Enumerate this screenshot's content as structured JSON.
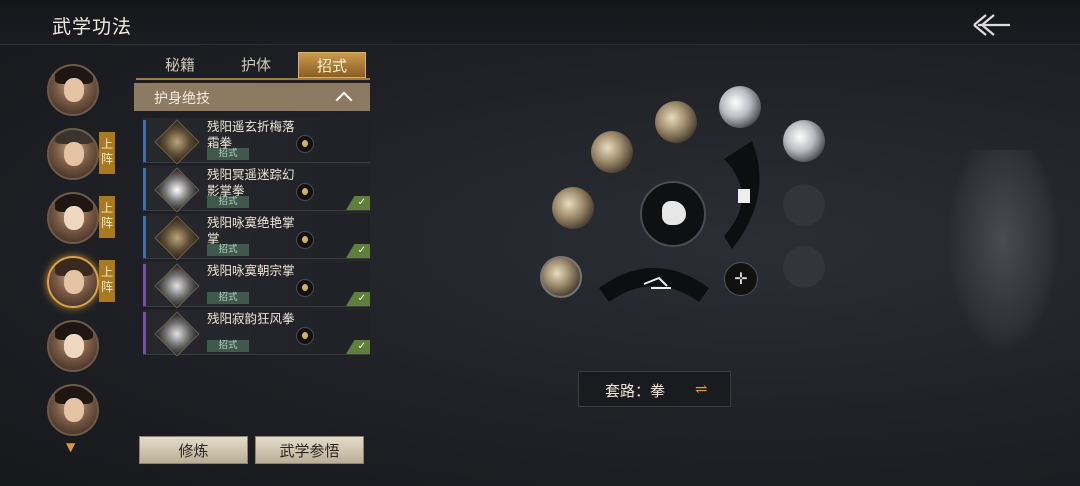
{
  "header": {
    "title": "武学功法"
  },
  "characters": [
    {
      "badge": ""
    },
    {
      "badge": "上阵"
    },
    {
      "badge": "上阵"
    },
    {
      "badge": "上阵"
    },
    {
      "badge": ""
    },
    {
      "badge": ""
    }
  ],
  "tabs": [
    "秘籍",
    "护体",
    "招式"
  ],
  "active_tab": "招式",
  "section": {
    "title": "护身绝技"
  },
  "skills": [
    {
      "name": "残阳遥玄折梅落霜拳",
      "tag": "招式",
      "equipped": false,
      "accent": "#3f6fb0"
    },
    {
      "name": "残阳冥遥迷踪幻影掌拳",
      "tag": "招式",
      "equipped": true,
      "accent": "#3f6fb0"
    },
    {
      "name": "残阳咏寞绝艳掌掌",
      "tag": "招式",
      "equipped": true,
      "accent": "#3f6fb0"
    },
    {
      "name": "残阳咏寞朝宗掌",
      "tag": "招式",
      "equipped": true,
      "accent": "#7a4fb0"
    },
    {
      "name": "残阳寂韵狂风拳",
      "tag": "招式",
      "equipped": true,
      "accent": "#7a4fb0"
    }
  ],
  "buttons": {
    "practice": "修炼",
    "comprehend": "武学参悟"
  },
  "taolu": {
    "label": "套路：拳",
    "switch_icon": "⇌"
  }
}
